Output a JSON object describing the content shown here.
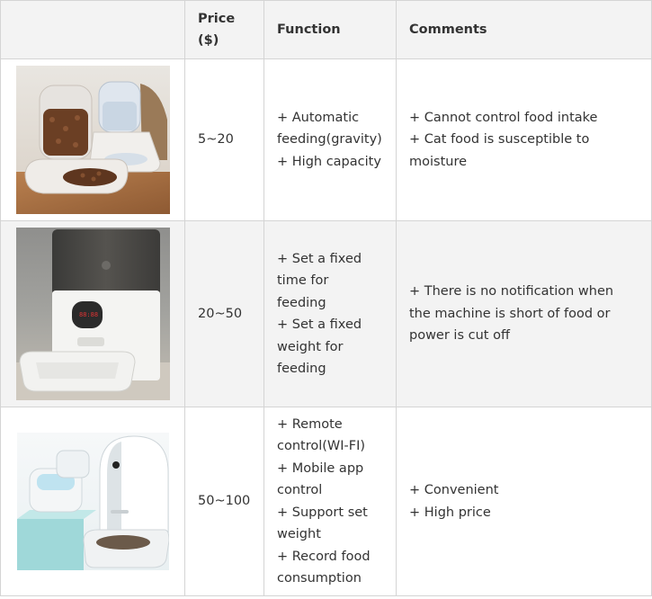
{
  "table": {
    "headers": [
      "",
      "Price\n($)",
      "Function",
      "Comments"
    ],
    "rows": [
      {
        "image": "gravity-feeder-with-water-dispenser",
        "price": "5~20",
        "function": "+ Automatic\nfeeding(gravity)\n+ High capacity",
        "comments": "+ Cannot control food intake\n+ Cat food is susceptible to\nmoisture"
      },
      {
        "image": "timed-automatic-feeder",
        "price": "20~50",
        "function": "+ Set a fixed\ntime for\nfeeding\n+ Set a fixed\nweight for\nfeeding",
        "comments": "+ There is no notification when\nthe machine is short of food or\npower is cut off"
      },
      {
        "image": "smart-wifi-feeder-with-fountain",
        "price": "50~100",
        "function": "+ Remote\ncontrol(WI-FI)\n+ Mobile app\ncontrol\n+ Support set\nweight\n+ Record food\nconsumption",
        "comments": "+ Convenient\n+ High price"
      }
    ]
  }
}
